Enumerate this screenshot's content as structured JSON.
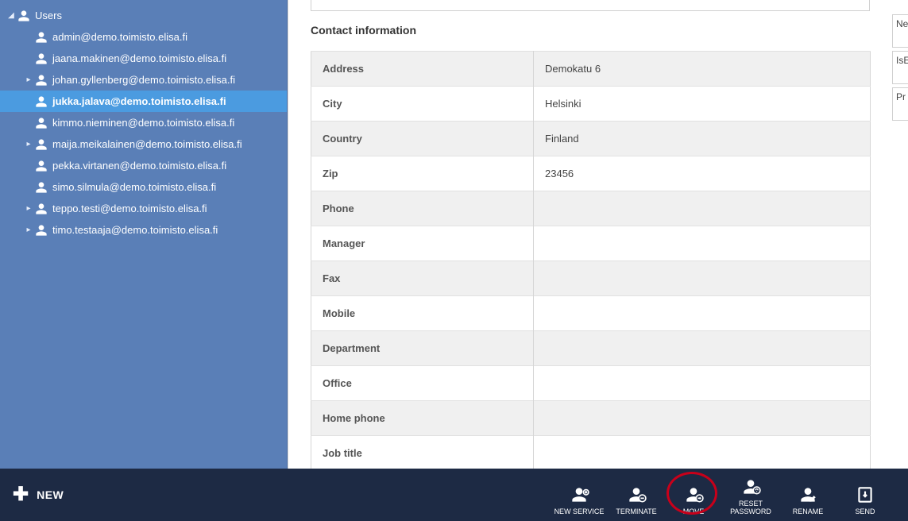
{
  "sidebar": {
    "root_label": "Users",
    "items": [
      {
        "label": "admin@demo.toimisto.elisa.fi",
        "expandable": false
      },
      {
        "label": "jaana.makinen@demo.toimisto.elisa.fi",
        "expandable": false
      },
      {
        "label": "johan.gyllenberg@demo.toimisto.elisa.fi",
        "expandable": true
      },
      {
        "label": "jukka.jalava@demo.toimisto.elisa.fi",
        "expandable": false,
        "selected": true
      },
      {
        "label": "kimmo.nieminen@demo.toimisto.elisa.fi",
        "expandable": false
      },
      {
        "label": "maija.meikalainen@demo.toimisto.elisa.fi",
        "expandable": true
      },
      {
        "label": "pekka.virtanen@demo.toimisto.elisa.fi",
        "expandable": false
      },
      {
        "label": "simo.silmula@demo.toimisto.elisa.fi",
        "expandable": false
      },
      {
        "label": "teppo.testi@demo.toimisto.elisa.fi",
        "expandable": true
      },
      {
        "label": "timo.testaaja@demo.toimisto.elisa.fi",
        "expandable": true
      }
    ]
  },
  "content": {
    "section_title": "Contact information",
    "rows": [
      {
        "label": "Address",
        "value": "Demokatu 6"
      },
      {
        "label": "City",
        "value": "Helsinki"
      },
      {
        "label": "Country",
        "value": "Finland"
      },
      {
        "label": "Zip",
        "value": "23456"
      },
      {
        "label": "Phone",
        "value": ""
      },
      {
        "label": "Manager",
        "value": ""
      },
      {
        "label": "Fax",
        "value": ""
      },
      {
        "label": "Mobile",
        "value": ""
      },
      {
        "label": "Department",
        "value": ""
      },
      {
        "label": "Office",
        "value": ""
      },
      {
        "label": "Home phone",
        "value": ""
      },
      {
        "label": "Job title",
        "value": ""
      }
    ]
  },
  "right_panel": {
    "items": [
      "Ne",
      "IsE",
      "Pr"
    ]
  },
  "footer": {
    "new_label": "NEW",
    "actions": [
      {
        "id": "new-service",
        "label": "NEW SERVICE"
      },
      {
        "id": "terminate",
        "label": "TERMINATE"
      },
      {
        "id": "move",
        "label": "MOVE",
        "highlighted": true
      },
      {
        "id": "reset-password",
        "label": "RESET\nPASSWORD"
      },
      {
        "id": "rename",
        "label": "RENAME"
      },
      {
        "id": "send",
        "label": "SEND"
      }
    ]
  }
}
